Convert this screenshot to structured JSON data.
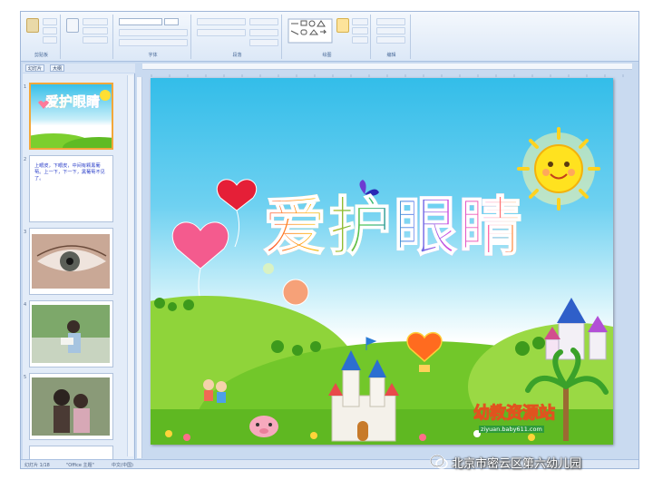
{
  "ribbon": {
    "groups": [
      "剪贴板",
      "字体",
      "段落",
      "绘图",
      "编辑"
    ]
  },
  "panel": {
    "tabs": [
      "幻灯片",
      "大纲"
    ]
  },
  "thumbnails": [
    {
      "num": "1",
      "title": "爱护眼睛",
      "selected": true
    },
    {
      "num": "2",
      "text": "上眼皮，下眼皮，中间有颗黑葡萄。上一下，下一下，黑葡萄不见了。",
      "selected": false
    },
    {
      "num": "3",
      "selected": false
    },
    {
      "num": "4",
      "selected": false
    },
    {
      "num": "5",
      "selected": false
    }
  ],
  "slide": {
    "title": "爱护眼睛",
    "logo_text": "幼教资源站",
    "logo_url": "ziyuan.baby611.com"
  },
  "statusbar": {
    "left": "幻灯片 1/18",
    "theme": "\"Office 主题\"",
    "lang": "中文(中国)"
  },
  "watermark": {
    "text": "北京市密云区第六幼儿园"
  },
  "colors": {
    "sky_top": "#33bde9",
    "grass": "#7ccf2e",
    "selection": "#f3a73a",
    "ribbon_bg": "#dce8f7"
  }
}
